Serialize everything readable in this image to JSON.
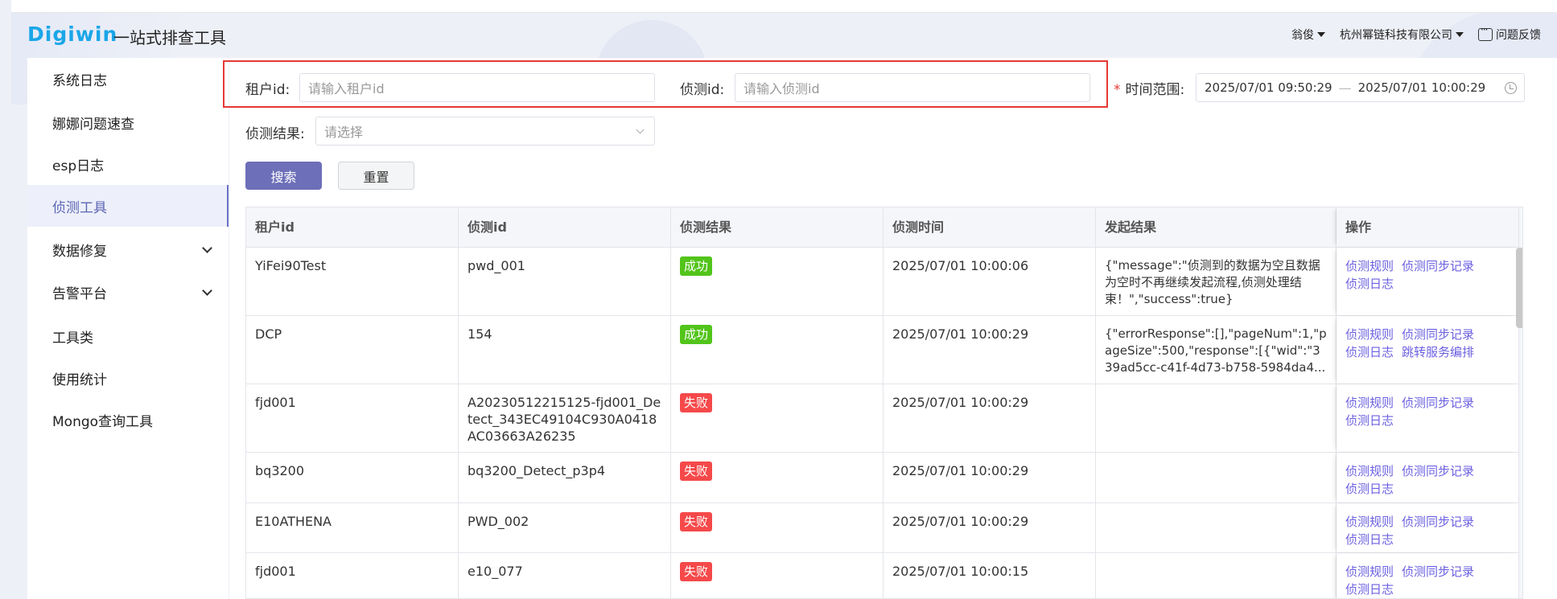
{
  "header": {
    "logo": "Digiwin",
    "app_title": "一站式排查工具",
    "user": "翁俊",
    "company": "杭州幂链科技有限公司",
    "feedback": "问题反馈"
  },
  "sidebar": {
    "items": [
      {
        "label": "系统日志",
        "active": false,
        "expandable": false
      },
      {
        "label": "娜娜问题速查",
        "active": false,
        "expandable": false
      },
      {
        "label": "esp日志",
        "active": false,
        "expandable": false
      },
      {
        "label": "侦测工具",
        "active": true,
        "expandable": false
      },
      {
        "label": "数据修复",
        "active": false,
        "expandable": true
      },
      {
        "label": "告警平台",
        "active": false,
        "expandable": true
      },
      {
        "label": "工具类",
        "active": false,
        "expandable": false
      },
      {
        "label": "使用统计",
        "active": false,
        "expandable": false
      },
      {
        "label": "Mongo查询工具",
        "active": false,
        "expandable": false
      }
    ]
  },
  "filters": {
    "tenant_label": "租户id:",
    "tenant_placeholder": "请输入租户id",
    "detect_label": "侦测id:",
    "detect_placeholder": "请输入侦测id",
    "required_mark": "*",
    "time_label": "时间范围:",
    "time_start": "2025/07/01 09:50:29",
    "time_sep": "—",
    "time_end": "2025/07/01 10:00:29",
    "result_label": "侦测结果:",
    "result_placeholder": "请选择",
    "search_btn": "搜索",
    "reset_btn": "重置"
  },
  "table": {
    "columns": [
      "租户id",
      "侦测id",
      "侦测结果",
      "侦测时间",
      "发起结果",
      "操作"
    ],
    "rows": [
      {
        "tenant": "YiFei90Test",
        "detect_id": "pwd_001",
        "result": "成功",
        "status": "ok",
        "time": "2025/07/01 10:00:06",
        "initiate": "{\"message\":\"侦测到的数据为空且数据为空时不再继续发起流程,侦测处理结束！\",\"success\":true}",
        "ops": [
          "侦测规则",
          "侦测同步记录",
          "侦测日志"
        ]
      },
      {
        "tenant": "DCP",
        "detect_id": "154",
        "result": "成功",
        "status": "ok",
        "time": "2025/07/01 10:00:29",
        "initiate": "{\"errorResponse\":[],\"pageNum\":1,\"pageSize\":500,\"response\":[{\"wid\":\"339ad5cc-c41f-4d73-b758-5984da4...",
        "ops": [
          "侦测规则",
          "侦测同步记录",
          "侦测日志",
          "跳转服务编排"
        ]
      },
      {
        "tenant": "fjd001",
        "detect_id": "A20230512215125-fjd001_Detect_343EC49104C930A0418AC03663A26235",
        "result": "失败",
        "status": "fail",
        "time": "2025/07/01 10:00:29",
        "initiate": "",
        "ops": [
          "侦测规则",
          "侦测同步记录",
          "侦测日志"
        ]
      },
      {
        "tenant": "bq3200",
        "detect_id": "bq3200_Detect_p3p4",
        "result": "失败",
        "status": "fail",
        "time": "2025/07/01 10:00:29",
        "initiate": "",
        "ops": [
          "侦测规则",
          "侦测同步记录",
          "侦测日志"
        ]
      },
      {
        "tenant": "E10ATHENA",
        "detect_id": "PWD_002",
        "result": "失败",
        "status": "fail",
        "time": "2025/07/01 10:00:29",
        "initiate": "",
        "ops": [
          "侦测规则",
          "侦测同步记录",
          "侦测日志"
        ]
      },
      {
        "tenant": "fjd001",
        "detect_id": "e10_077",
        "result": "失败",
        "status": "fail",
        "time": "2025/07/01 10:00:15",
        "initiate": "",
        "ops": [
          "侦测规则",
          "侦测同步记录",
          "侦测日志"
        ]
      }
    ]
  },
  "colors": {
    "primary": "#6d6fb8",
    "success": "#52c41a",
    "fail": "#f5494a",
    "link": "#6b5fe0",
    "logo": "#1aa6e8",
    "highlight": "#e53935"
  }
}
